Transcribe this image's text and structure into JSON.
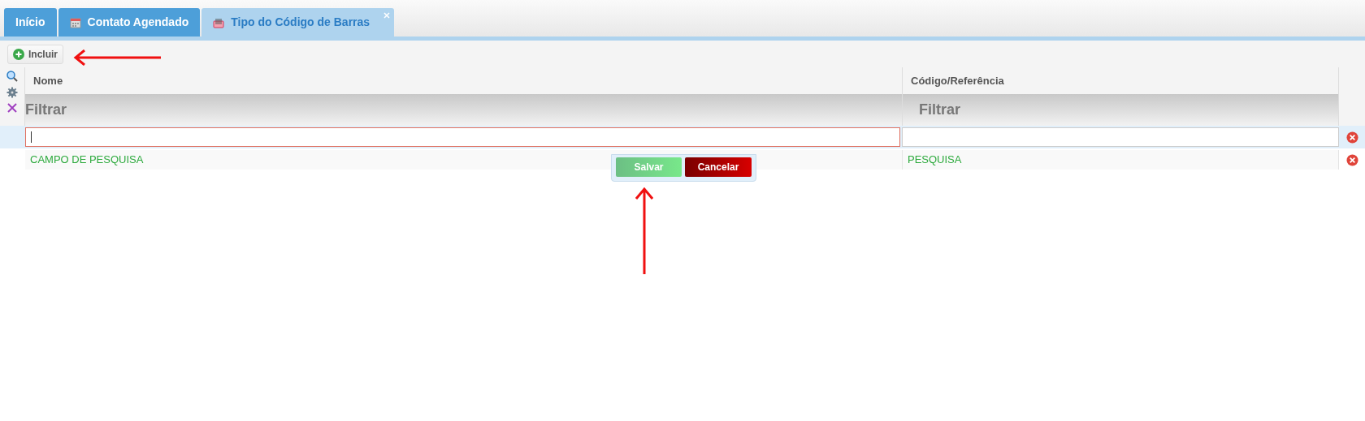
{
  "tabs": [
    {
      "label": "Início",
      "selected": false,
      "kind": "plain",
      "closable": false
    },
    {
      "label": "Contato Agendado",
      "selected": false,
      "kind": "calendar",
      "closable": false
    },
    {
      "label": "Tipo do Código de Barras",
      "selected": true,
      "kind": "barcode",
      "closable": true
    }
  ],
  "toolbar": {
    "add_button": "Incluir"
  },
  "table": {
    "columns": [
      "Nome",
      "Código/Referência"
    ],
    "filters": [
      "Filtrar",
      "Filtrar"
    ],
    "edit_row": {
      "fields": [
        {
          "focused": true
        },
        {
          "focused": false
        }
      ]
    },
    "rows": [
      {
        "cells": [
          "CAMPO DE PESQUISA",
          "PESQUISA"
        ]
      }
    ]
  },
  "row_editor": {
    "save": "Salvar",
    "cancel": "Cancelar"
  }
}
